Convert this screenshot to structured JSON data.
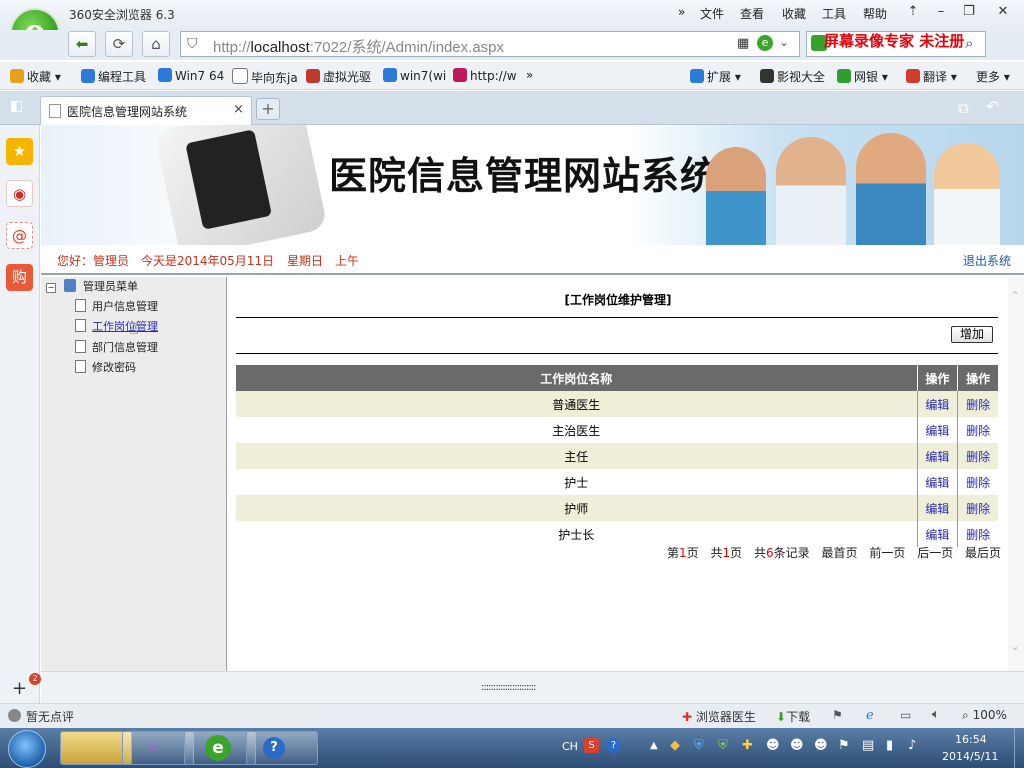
{
  "browser": {
    "title": "360安全浏览器 6.3",
    "menu": [
      "文件",
      "查看",
      "收藏",
      "工具",
      "帮助"
    ],
    "url_prefix": "http://",
    "url_host": "localhost",
    "url_rest": ":7022/系统/Admin/index.aspx",
    "watermark": "屏幕录像专家  未注册"
  },
  "favorites": [
    {
      "label": "收藏",
      "color": "#e8a21a"
    },
    {
      "label": "编程工具",
      "color": "#2a7ad6"
    },
    {
      "label": "Win7 64",
      "color": "#2a7ad6"
    },
    {
      "label": "毕向东ja",
      "color": "#ffffff"
    },
    {
      "label": "虚拟光驱",
      "color": "#c0392b"
    },
    {
      "label": "win7(wi",
      "color": "#2a7ad6"
    },
    {
      "label": "http://w",
      "color": "#c2185b"
    }
  ],
  "favorites_right": [
    {
      "label": "扩展",
      "color": "#2a7ad6"
    },
    {
      "label": "影视大全",
      "color": "#333333"
    },
    {
      "label": "网银",
      "color": "#2e9e2e"
    },
    {
      "label": "翻译",
      "color": "#d23a2a"
    },
    {
      "label": "更多",
      "color": "#eef2f6"
    }
  ],
  "tab": {
    "label": "医院信息管理网站系统",
    "close": "×",
    "new": "+"
  },
  "site": {
    "banner_title": "医院信息管理网站系统",
    "greeting": "您好：管理员",
    "date": "今天是2014年05月11日",
    "weekday": "星期日",
    "ampm": "上午",
    "logout": "退出系统"
  },
  "tree": {
    "root": "管理员菜单",
    "items": [
      "用户信息管理",
      "工作岗位管理",
      "部门信息管理",
      "修改密码"
    ]
  },
  "page": {
    "heading": "[工作岗位维护管理]",
    "add_button": "增加",
    "columns": [
      "工作岗位名称",
      "操作",
      "操作"
    ],
    "rows": [
      {
        "name": "普通医生",
        "edit": "编辑",
        "delete": "删除"
      },
      {
        "name": "主治医生",
        "edit": "编辑",
        "delete": "删除"
      },
      {
        "name": "主任",
        "edit": "编辑",
        "delete": "删除"
      },
      {
        "name": "护士",
        "edit": "编辑",
        "delete": "删除"
      },
      {
        "name": "护师",
        "edit": "编辑",
        "delete": "删除"
      },
      {
        "name": "护士长",
        "edit": "编辑",
        "delete": "删除"
      }
    ],
    "pager": {
      "page_prefix": "第",
      "page": "1",
      "page_suffix": "页",
      "total_prefix": "共",
      "total": "1",
      "total_suffix": "页",
      "rec_prefix": "共",
      "records": "6",
      "rec_suffix": "条记录",
      "first": "最首页",
      "prev": "前一页",
      "next": "后一页",
      "last": "最后页"
    }
  },
  "bottombar": {
    "grip": ":::::::::::::::::::::::"
  },
  "status": {
    "left": "暂无点评",
    "doctor": "浏览器医生",
    "download": "下载",
    "zoom": "100%"
  },
  "taskbar": {
    "lang": "CH",
    "time": "16:54",
    "date": "2014/5/11"
  },
  "sidebar_badge": "2"
}
